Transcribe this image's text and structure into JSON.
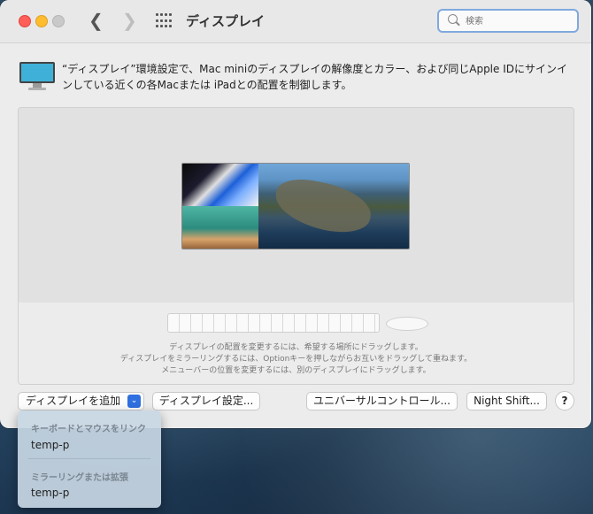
{
  "window": {
    "title": "ディスプレイ"
  },
  "search": {
    "placeholder": "検索"
  },
  "description": {
    "text": "“ディスプレイ”環境設定で、Mac miniのディスプレイの解像度とカラー、および同じApple IDにサインインしている近くの各Macまたは iPadとの配置を制御します。"
  },
  "arrangement": {
    "hints": [
      "ディスプレイの配置を変更するには、希望する場所にドラッグします。",
      "ディスプレイをミラーリングするには、Optionキーを押しながらお互いをドラッグして重ねます。",
      "メニューバーの位置を変更するには、別のディスプレイにドラッグします。"
    ]
  },
  "buttons": {
    "add_display": "ディスプレイを追加",
    "display_settings": "ディスプレイ設定...",
    "universal_control": "ユニバーサルコントロール...",
    "night_shift": "Night Shift...",
    "help": "?"
  },
  "menu": {
    "section1": "キーボードとマウスをリンク",
    "item1": "temp-p",
    "section2": "ミラーリングまたは拡張",
    "item2": "temp-p"
  },
  "icons": {
    "back": "chevron-left-icon",
    "forward": "chevron-right-icon",
    "grid": "grid-icon",
    "search": "search-icon",
    "display": "display-icon"
  },
  "colors": {
    "accent": "#2f6fdf",
    "close": "#ff5f57",
    "minimize": "#febc2e",
    "search_focus": "#7fa9de"
  }
}
